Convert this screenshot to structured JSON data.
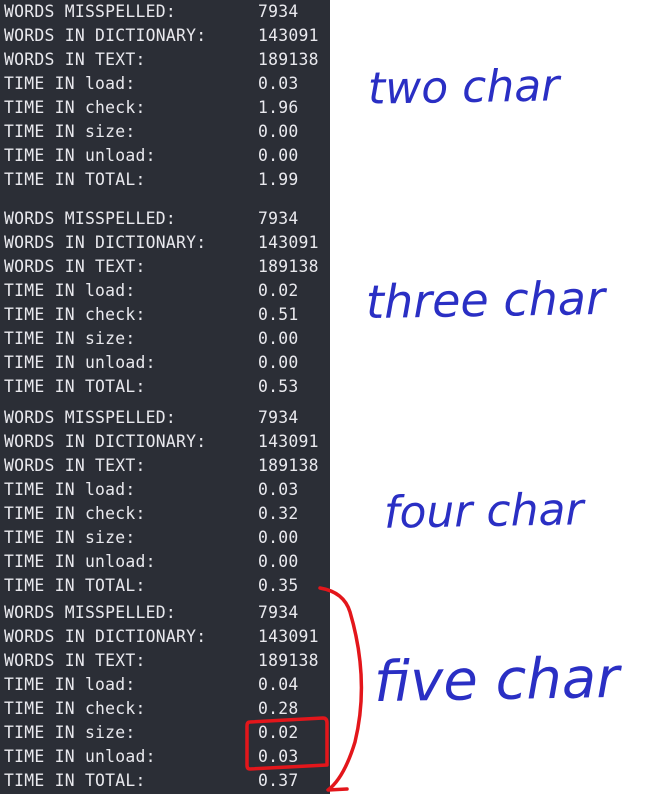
{
  "runs": [
    {
      "rows": [
        {
          "label": "WORDS MISSPELLED:",
          "value": "7934"
        },
        {
          "label": "WORDS IN DICTIONARY:",
          "value": "143091"
        },
        {
          "label": "WORDS IN TEXT:",
          "value": "189138"
        },
        {
          "label": "TIME IN load:",
          "value": "0.03"
        },
        {
          "label": "TIME IN check:",
          "value": "1.96"
        },
        {
          "label": "TIME IN size:",
          "value": "0.00"
        },
        {
          "label": "TIME IN unload:",
          "value": "0.00"
        },
        {
          "label": "TIME IN TOTAL:",
          "value": "1.99"
        }
      ],
      "note": "two char"
    },
    {
      "rows": [
        {
          "label": "WORDS MISSPELLED:",
          "value": "7934"
        },
        {
          "label": "WORDS IN DICTIONARY:",
          "value": "143091"
        },
        {
          "label": "WORDS IN TEXT:",
          "value": "189138"
        },
        {
          "label": "TIME IN load:",
          "value": "0.02"
        },
        {
          "label": "TIME IN check:",
          "value": "0.51"
        },
        {
          "label": "TIME IN size:",
          "value": "0.00"
        },
        {
          "label": "TIME IN unload:",
          "value": "0.00"
        },
        {
          "label": "TIME IN TOTAL:",
          "value": "0.53"
        }
      ],
      "note": "three char"
    },
    {
      "rows": [
        {
          "label": "WORDS MISSPELLED:",
          "value": "7934"
        },
        {
          "label": "WORDS IN DICTIONARY:",
          "value": "143091"
        },
        {
          "label": "WORDS IN TEXT:",
          "value": "189138"
        },
        {
          "label": "TIME IN load:",
          "value": "0.03"
        },
        {
          "label": "TIME IN check:",
          "value": "0.32"
        },
        {
          "label": "TIME IN size:",
          "value": "0.00"
        },
        {
          "label": "TIME IN unload:",
          "value": "0.00"
        },
        {
          "label": "TIME IN TOTAL:",
          "value": "0.35"
        }
      ],
      "note": "four char"
    },
    {
      "rows": [
        {
          "label": "WORDS MISSPELLED:",
          "value": "7934"
        },
        {
          "label": "WORDS IN DICTIONARY:",
          "value": "143091"
        },
        {
          "label": "WORDS IN TEXT:",
          "value": "189138"
        },
        {
          "label": "TIME IN load:",
          "value": "0.04"
        },
        {
          "label": "TIME IN check:",
          "value": "0.28"
        },
        {
          "label": "TIME IN size:",
          "value": "0.02"
        },
        {
          "label": "TIME IN unload:",
          "value": "0.03"
        },
        {
          "label": "TIME IN TOTAL:",
          "value": "0.37"
        }
      ],
      "note": "five char"
    }
  ],
  "colors": {
    "terminal_bg": "#2b2e36",
    "terminal_text": "#e9e9ee",
    "handwriting": "#2a2fc4",
    "highlight": "#e3161b"
  }
}
